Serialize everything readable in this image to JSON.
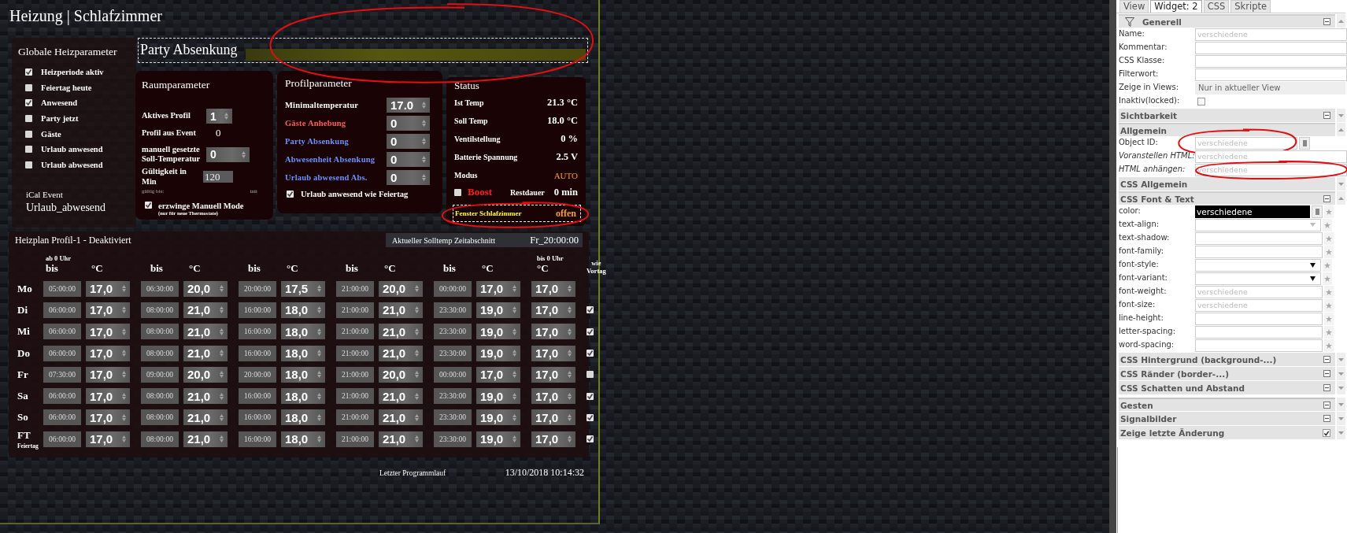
{
  "title": "Heizung | Schlafzimmer",
  "global_params": {
    "title": "Globale Heizparameter",
    "checkboxes": [
      {
        "label": "Heizperiode aktiv",
        "checked": true
      },
      {
        "label": "Feiertag heute",
        "checked": false
      },
      {
        "label": "Anwesend",
        "checked": true
      },
      {
        "label": "Party jetzt",
        "checked": false
      },
      {
        "label": "Gäste",
        "checked": false
      },
      {
        "label": "Urlaub anwesend",
        "checked": false
      },
      {
        "label": "Urlaub abwesend",
        "checked": false
      }
    ],
    "ical_label": "iCal Event",
    "ical_value": "Urlaub_abwesend"
  },
  "party": {
    "title": "Party Absenkung",
    "circled": true
  },
  "room_params": {
    "title": "Raumparameter",
    "rows": [
      {
        "kind": "select",
        "label": "Aktives Profil",
        "value": "1"
      },
      {
        "kind": "value",
        "label": "Profil aus Event",
        "value": "0"
      },
      {
        "kind": "select",
        "label": "manuell gesetzte Soll-Temperatur",
        "value": "0"
      },
      {
        "kind": "input",
        "label": "Gültigkeit in Min",
        "value": "120"
      },
      {
        "kind": "small",
        "label": "gültig bis:",
        "value": "init"
      }
    ],
    "force": {
      "label": "erzwinge Manuell Mode",
      "note": "(nur für neue Thermostate)",
      "checked": true
    }
  },
  "profile_params": {
    "title": "Profilparameter",
    "rows": [
      {
        "label": "Minimaltemperatur",
        "value": "17.0",
        "color": "#ffffff"
      },
      {
        "label": "Gäste Anhebung",
        "value": "0",
        "color": "#ff5a5a"
      },
      {
        "label": "Party Absenkung",
        "value": "0",
        "color": "#6f8fff"
      },
      {
        "label": "Abwesenheit Absenkung",
        "value": "0",
        "color": "#6f8fff"
      },
      {
        "label": "Urlaub abwesend Abs.",
        "value": "0",
        "color": "#6f8fff"
      }
    ],
    "checkbox": {
      "label": "Urlaub anwesend wie Feiertag",
      "checked": true
    }
  },
  "status": {
    "title": "Status",
    "rows": [
      {
        "kind": "plain",
        "label": "Ist Temp",
        "value": "21.3 °C"
      },
      {
        "kind": "plain",
        "label": "Soll Temp",
        "value": "18.0 °C"
      },
      {
        "kind": "plain",
        "label": "Ventilstellung",
        "value": "0 %"
      },
      {
        "kind": "plain",
        "label": "Batterie Spannung",
        "value": "2.5 V"
      },
      {
        "kind": "highlight",
        "label": "Modus",
        "value": "AUTO"
      }
    ],
    "boost": {
      "label": "Boost",
      "checked": false,
      "remaining_label": "Restdauer",
      "remaining": "0 min"
    },
    "window": {
      "label": "Fenster Schlafzimmer",
      "value": "offen",
      "circled": true
    }
  },
  "schedule": {
    "title": "Heizplan Profil-1 - Deaktiviert",
    "current_label": "Aktueller Solltemp Zeitabschnitt",
    "current_value": "Fr_20:00:00",
    "columns": [
      {
        "top": "ab 0 Uhr",
        "time": "bis",
        "temp": "°C"
      },
      {
        "time": "bis",
        "temp": "°C"
      },
      {
        "time": "bis",
        "temp": "°C"
      },
      {
        "time": "bis",
        "temp": "°C"
      },
      {
        "time": "bis",
        "temp": "°C"
      },
      {
        "top": "bis 0 Uhr",
        "temp": "°C"
      }
    ],
    "same_label": "wie Vortag",
    "rows": [
      {
        "day": "Mo",
        "times": [
          "05:00:00",
          "06:30:00",
          "20:00:00",
          "21:00:00",
          "00:00:00"
        ],
        "temps": [
          "17,0",
          "20,0",
          "17,5",
          "20,0",
          "17,0",
          "17,0"
        ]
      },
      {
        "day": "Di",
        "times": [
          "06:00:00",
          "08:00:00",
          "16:00:00",
          "21:00:00",
          "23:30:00"
        ],
        "temps": [
          "17,0",
          "21,0",
          "18,0",
          "21,0",
          "19,0",
          "17,0"
        ],
        "same_as_previous": true
      },
      {
        "day": "Mi",
        "times": [
          "06:00:00",
          "08:00:00",
          "16:00:00",
          "21:00:00",
          "23:30:00"
        ],
        "temps": [
          "17,0",
          "21,0",
          "18,0",
          "21,0",
          "19,0",
          "17,0"
        ],
        "same_as_previous": true
      },
      {
        "day": "Do",
        "times": [
          "06:00:00",
          "08:00:00",
          "16:00:00",
          "21:00:00",
          "23:30:00"
        ],
        "temps": [
          "17,0",
          "21,0",
          "18,0",
          "21,0",
          "19,0",
          "17,0"
        ],
        "same_as_previous": true
      },
      {
        "day": "Fr",
        "times": [
          "07:30:00",
          "09:00:00",
          "20:00:00",
          "21:00:00",
          "00:00:00"
        ],
        "temps": [
          "17,0",
          "20,0",
          "18,0",
          "20,0",
          "17,0",
          "17,0"
        ],
        "same_as_previous": false
      },
      {
        "day": "Sa",
        "times": [
          "06:00:00",
          "08:00:00",
          "16:00:00",
          "21:00:00",
          "23:30:00"
        ],
        "temps": [
          "17,0",
          "21,0",
          "18,0",
          "21,0",
          "19,0",
          "17,0"
        ],
        "same_as_previous": true
      },
      {
        "day": "So",
        "times": [
          "06:00:00",
          "08:00:00",
          "16:00:00",
          "21:00:00",
          "23:30:00"
        ],
        "temps": [
          "17,0",
          "21,0",
          "18,0",
          "21,0",
          "19,0",
          "17,0"
        ],
        "same_as_previous": true
      },
      {
        "day": "FT",
        "sub": "Feiertag",
        "times": [
          "06:00:00",
          "08:00:00",
          "16:00:00",
          "21:00:00",
          "23:30:00"
        ],
        "temps": [
          "17,0",
          "21,0",
          "18,0",
          "21,0",
          "19,0",
          "17,0"
        ],
        "same_as_previous": true
      }
    ]
  },
  "footer": {
    "label": "Letzter Programmlauf",
    "value": "13/10/2018 10:14:32"
  },
  "editor": {
    "tabs": [
      {
        "label": "View",
        "selected": false
      },
      {
        "label": "Widget: 2",
        "selected": true
      },
      {
        "label": "CSS",
        "selected": false
      },
      {
        "label": "Skripte",
        "selected": false
      }
    ],
    "sections": [
      {
        "kind": "group",
        "title": "Generell",
        "filter": true,
        "expanded": true,
        "rows": [
          {
            "kind": "text",
            "label": "Name:",
            "placeholder": "verschiedene"
          },
          {
            "kind": "text",
            "label": "Kommentar:"
          },
          {
            "kind": "text",
            "label": "CSS Klasse:"
          },
          {
            "kind": "text",
            "label": "Filterwort:"
          },
          {
            "kind": "select",
            "label": "Zeige in Views:",
            "value": "Nur in aktueller View"
          },
          {
            "kind": "checkbox",
            "label": "Inaktiv(locked):",
            "checked": false
          }
        ]
      },
      {
        "kind": "group",
        "title": "Sichtbarkeit",
        "expanded": false
      },
      {
        "kind": "plain",
        "title": "Allgemein",
        "expanded": true,
        "rows": [
          {
            "kind": "text-button",
            "label": "Object ID:",
            "placeholder": "verschiedene",
            "circled": true
          },
          {
            "kind": "text",
            "label": "Voranstellen HTML:",
            "placeholder": "verschiedene",
            "italic": true
          },
          {
            "kind": "text",
            "label": "HTML anhängen:",
            "placeholder": "verschiedene",
            "italic": true,
            "circled": true
          }
        ]
      },
      {
        "kind": "plain",
        "title": "CSS Allgemein",
        "expanded": false
      },
      {
        "kind": "group",
        "title": "CSS Font & Text",
        "expanded": true,
        "rows": [
          {
            "kind": "color",
            "label": "color:",
            "value": "verschiedene"
          },
          {
            "kind": "light-select",
            "label": "text-align:"
          },
          {
            "kind": "star-text",
            "label": "text-shadow:"
          },
          {
            "kind": "star-text",
            "label": "font-family:"
          },
          {
            "kind": "star-select",
            "label": "font-style:"
          },
          {
            "kind": "star-select",
            "label": "font-variant:"
          },
          {
            "kind": "star-text",
            "label": "font-weight:",
            "placeholder": "verschiedene"
          },
          {
            "kind": "star-text",
            "label": "font-size:",
            "placeholder": "verschiedene"
          },
          {
            "kind": "star-text",
            "label": "line-height:"
          },
          {
            "kind": "star-text",
            "label": "letter-spacing:"
          },
          {
            "kind": "star-text",
            "label": "word-spacing:"
          }
        ]
      },
      {
        "kind": "group",
        "title": "CSS Hintergrund (background-...)",
        "expanded": false
      },
      {
        "kind": "group",
        "title": "CSS Ränder (border-...)",
        "expanded": false
      },
      {
        "kind": "group",
        "title": "CSS Schatten und Abstand",
        "expanded": false
      },
      {
        "kind": "group",
        "title": "Gesten",
        "expanded": false,
        "gap": true
      },
      {
        "kind": "group",
        "title": "Signalbilder",
        "expanded": false
      },
      {
        "kind": "toggle",
        "title": "Zeige letzte Änderung",
        "expanded": false,
        "checked": true
      }
    ]
  }
}
